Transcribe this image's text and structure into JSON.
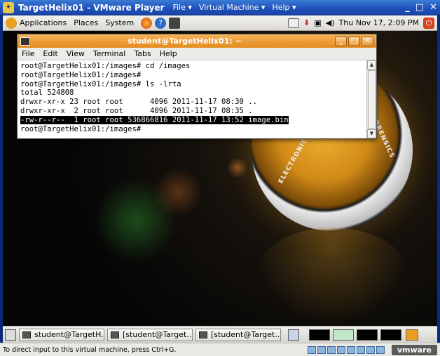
{
  "vmware": {
    "title": "TargetHelix01 - VMware Player",
    "menus": [
      {
        "label": "File"
      },
      {
        "label": "Virtual Machine"
      },
      {
        "label": "Help"
      }
    ],
    "status_text": "To direct input to this virtual machine, press Ctrl+G.",
    "brand": "vmware"
  },
  "gnome_panel": {
    "applications": "Applications",
    "places": "Places",
    "system": "System",
    "clock": "Thu Nov 17,  2:09 PM"
  },
  "terminal": {
    "title": "student@TargetHelix01: ~",
    "menu": [
      "File",
      "Edit",
      "View",
      "Terminal",
      "Tabs",
      "Help"
    ],
    "lines": [
      "root@TargetHelix01:/images# cd /images",
      "root@TargetHelix01:/images#",
      "root@TargetHelix01:/images# ls -lrta",
      "total 524808",
      "drwxr-xr-x 23 root root      4096 2011-11-17 08:30 ..",
      "drwxr-xr-x  2 root root      4096 2011-11-17 08:35 ."
    ],
    "highlighted_line": "-rw-r--r--  1 root root 536866816 2011-11-17 13:52 image.bin",
    "prompt_line": "root@TargetHelix01:/images#"
  },
  "desktop": {
    "logo_text_top": "COMPUTER FORENSICS",
    "logo_text_bottom": "ELECTRONIC D",
    "accent_color": "#e8a020"
  },
  "taskbar": {
    "items": [
      {
        "label": "student@TargetH..."
      },
      {
        "label": "[student@Target..."
      },
      {
        "label": "[student@Target..."
      }
    ]
  }
}
